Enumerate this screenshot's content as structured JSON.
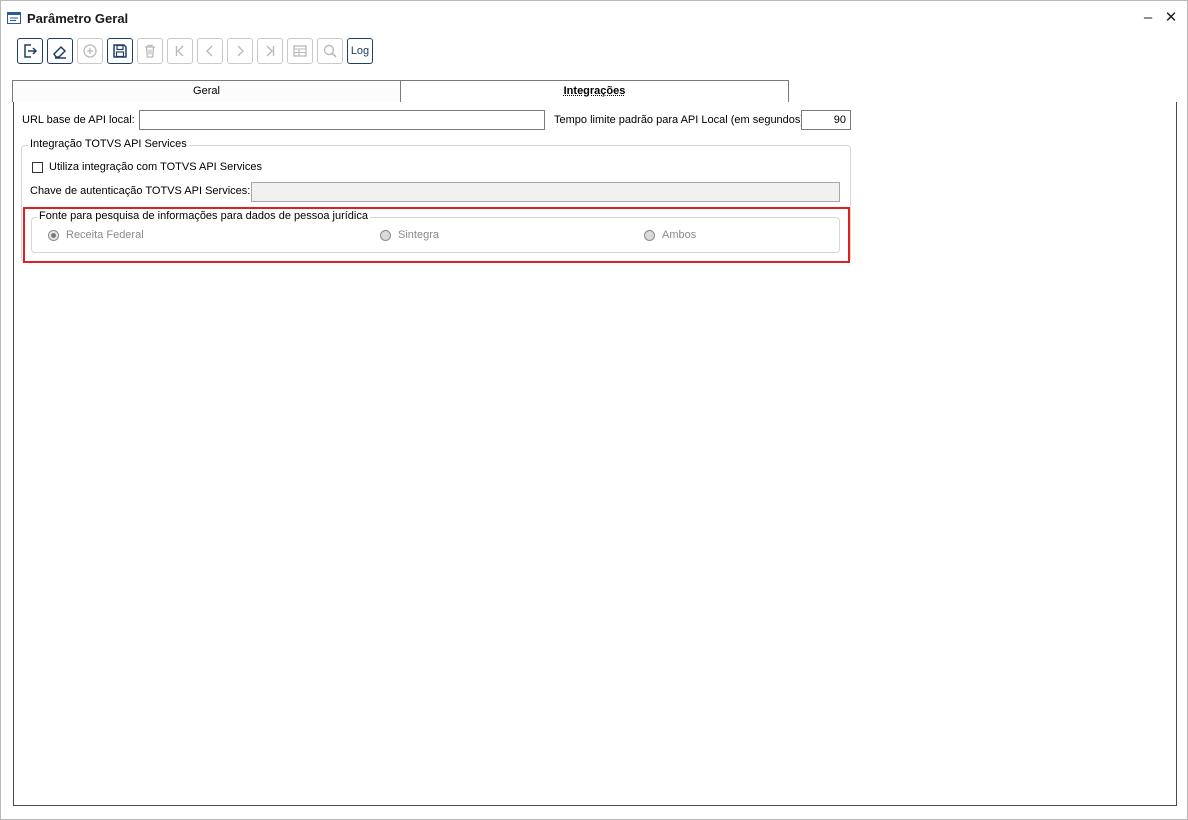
{
  "window": {
    "title": "Parâmetro Geral",
    "minimize_label": "–",
    "close_label": "✕"
  },
  "toolbar": {
    "buttons": [
      {
        "name": "exit-icon",
        "enabled": true
      },
      {
        "name": "eraser-icon",
        "enabled": true
      },
      {
        "name": "add-icon",
        "enabled": false
      },
      {
        "name": "save-icon",
        "enabled": true
      },
      {
        "name": "trash-icon",
        "enabled": false
      },
      {
        "name": "first-record-icon",
        "enabled": false
      },
      {
        "name": "previous-record-icon",
        "enabled": false
      },
      {
        "name": "next-record-icon",
        "enabled": false
      },
      {
        "name": "last-record-icon",
        "enabled": false
      },
      {
        "name": "grid-icon",
        "enabled": false
      },
      {
        "name": "search-icon",
        "enabled": false
      }
    ],
    "log_label": "Log"
  },
  "tabs": [
    {
      "label": "Geral",
      "active": false
    },
    {
      "label": "Integrações",
      "active": true
    }
  ],
  "form": {
    "url_label": "URL base de API local:",
    "url_value": "",
    "timeout_label": "Tempo limite padrão para API Local (em segundos):",
    "timeout_value": "90",
    "totvs_group": {
      "title": "Integração TOTVS API Services",
      "checkbox_label": "Utiliza integração com TOTVS API Services",
      "checkbox_checked": false,
      "key_label": "Chave de autenticação TOTVS API Services:",
      "key_value": ""
    },
    "source_group": {
      "title": "Fonte para pesquisa de informações para dados de pessoa jurídica",
      "options": [
        {
          "label": "Receita Federal",
          "selected": true
        },
        {
          "label": "Sintegra",
          "selected": false
        },
        {
          "label": "Ambos",
          "selected": false
        }
      ]
    }
  },
  "colors": {
    "toolbar_border": "#1f3f66",
    "highlight": "#e02020"
  }
}
